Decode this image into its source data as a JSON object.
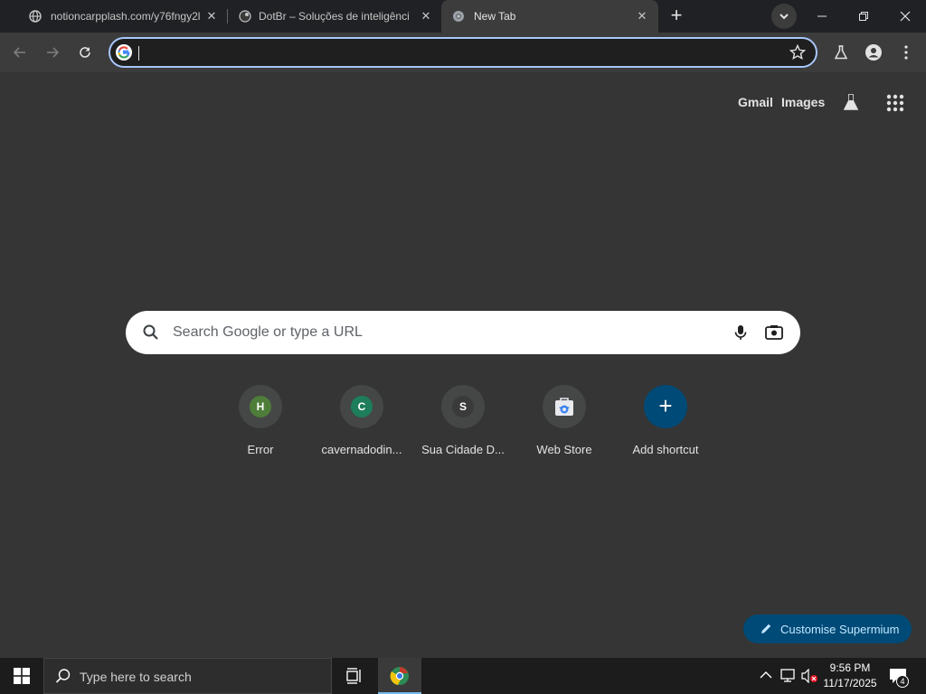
{
  "tabs": [
    {
      "title": "notioncarpplash.com/y76fngy2l",
      "favicon": "globe-icon",
      "active": false
    },
    {
      "title": "DotBr – Soluções de inteligência",
      "favicon": "dotbr-icon",
      "active": false
    },
    {
      "title": "New Tab",
      "favicon": "chrome-icon",
      "active": true
    }
  ],
  "toolbar": {
    "omnibox_value": ""
  },
  "ntp": {
    "links": {
      "gmail": "Gmail",
      "images": "Images"
    },
    "search_placeholder": "Search Google or type a URL",
    "shortcuts": [
      {
        "label": "Error",
        "letter": "H",
        "color": "#4e7d3a"
      },
      {
        "label": "cavernadodin...",
        "letter": "C",
        "color": "#1e7d5a"
      },
      {
        "label": "Sua Cidade D...",
        "letter": "S",
        "color": "#444746"
      },
      {
        "label": "Web Store",
        "letter": "",
        "color": ""
      },
      {
        "label": "Add shortcut",
        "letter": "+",
        "color": "#004a77"
      }
    ],
    "customise_label": "Customise Supermium"
  },
  "taskbar": {
    "search_placeholder": "Type here to search",
    "time": "9:56 PM",
    "date": "11/17/2025",
    "notification_count": "4"
  },
  "colors": {
    "accent": "#a8c7fa",
    "customise_bg": "#004a77",
    "ntp_bg": "#353535"
  }
}
